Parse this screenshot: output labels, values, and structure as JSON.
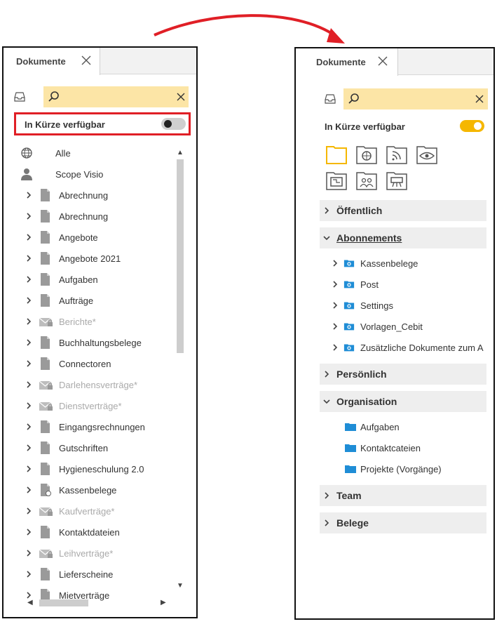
{
  "left_panel": {
    "tab_label": "Dokumente",
    "search": {
      "value": "",
      "placeholder": ""
    },
    "toggle": {
      "label": "In Kürze verfügbar",
      "state": "off"
    },
    "tree": [
      {
        "label": "Alle",
        "icon": "globe-icon",
        "expandable": false,
        "dim": false
      },
      {
        "label": "Scope Visio",
        "icon": "user-icon",
        "expandable": false,
        "dim": false
      },
      {
        "label": "Abrechnung",
        "icon": "document-icon",
        "expandable": true,
        "dim": false
      },
      {
        "label": "Abrechnung",
        "icon": "document-icon",
        "expandable": true,
        "dim": false
      },
      {
        "label": "Angebote",
        "icon": "document-icon",
        "expandable": true,
        "dim": false
      },
      {
        "label": "Angebote 2021",
        "icon": "document-icon",
        "expandable": true,
        "dim": false
      },
      {
        "label": "Aufgaben",
        "icon": "document-icon",
        "expandable": true,
        "dim": false
      },
      {
        "label": "Aufträge",
        "icon": "document-icon",
        "expandable": true,
        "dim": false
      },
      {
        "label": "Berichte*",
        "icon": "locked-mail-icon",
        "expandable": true,
        "dim": true
      },
      {
        "label": "Buchhaltungsbelege",
        "icon": "document-icon",
        "expandable": true,
        "dim": false
      },
      {
        "label": "Connectoren",
        "icon": "document-icon",
        "expandable": true,
        "dim": false
      },
      {
        "label": "Darlehensverträge*",
        "icon": "locked-mail-icon",
        "expandable": true,
        "dim": true
      },
      {
        "label": "Dienstverträge*",
        "icon": "locked-mail-icon",
        "expandable": true,
        "dim": true
      },
      {
        "label": "Eingangsrechnungen",
        "icon": "document-icon",
        "expandable": true,
        "dim": false
      },
      {
        "label": "Gutschriften",
        "icon": "document-icon",
        "expandable": true,
        "dim": false
      },
      {
        "label": "Hygieneschulung 2.0",
        "icon": "document-icon",
        "expandable": true,
        "dim": false
      },
      {
        "label": "Kassenbelege",
        "icon": "shared-document-icon",
        "expandable": true,
        "dim": false
      },
      {
        "label": "Kaufverträge*",
        "icon": "locked-mail-icon",
        "expandable": true,
        "dim": true
      },
      {
        "label": "Kontaktdateien",
        "icon": "document-icon",
        "expandable": true,
        "dim": false
      },
      {
        "label": "Leihverträge*",
        "icon": "locked-mail-icon",
        "expandable": true,
        "dim": true
      },
      {
        "label": "Lieferscheine",
        "icon": "document-icon",
        "expandable": true,
        "dim": false
      },
      {
        "label": "Mietverträge",
        "icon": "document-icon",
        "expandable": true,
        "dim": false
      }
    ]
  },
  "right_panel": {
    "tab_label": "Dokumente",
    "search": {
      "value": "",
      "placeholder": ""
    },
    "toggle": {
      "label": "In Kürze verfügbar",
      "state": "on"
    },
    "filter_icons": [
      "folder-icon",
      "public-folder-icon",
      "feed-folder-icon",
      "eye-folder-icon",
      "presentation-folder-icon",
      "team-folder-icon",
      "board-folder-icon"
    ],
    "sections": [
      {
        "label": "Öffentlich",
        "expanded": false,
        "underlined": false,
        "items": []
      },
      {
        "label": "Abonnements",
        "expanded": true,
        "underlined": true,
        "items": [
          {
            "label": "Kassenbelege",
            "expandable": true
          },
          {
            "label": "Post",
            "expandable": true
          },
          {
            "label": "Settings",
            "expandable": true
          },
          {
            "label": "Vorlagen_Cebit",
            "expandable": true
          },
          {
            "label": "Zusätzliche Dokumente zum A",
            "expandable": true
          }
        ]
      },
      {
        "label": "Persönlich",
        "expanded": false,
        "underlined": false,
        "items": []
      },
      {
        "label": "Organisation",
        "expanded": true,
        "underlined": false,
        "items": [
          {
            "label": "Aufgaben",
            "expandable": false
          },
          {
            "label": "Kontaktcateien",
            "expandable": false
          },
          {
            "label": "Projekte (Vorgänge)",
            "expandable": false
          }
        ]
      },
      {
        "label": "Team",
        "expanded": false,
        "underlined": false,
        "items": []
      },
      {
        "label": "Belege",
        "expanded": false,
        "underlined": false,
        "items": []
      }
    ]
  },
  "colors": {
    "search_bg": "#fce5a6",
    "toggle_on": "#f5b700",
    "toggle_off": "#cfcfcf",
    "highlight": "#e01f26",
    "folder_blue": "#1f8dd6"
  }
}
